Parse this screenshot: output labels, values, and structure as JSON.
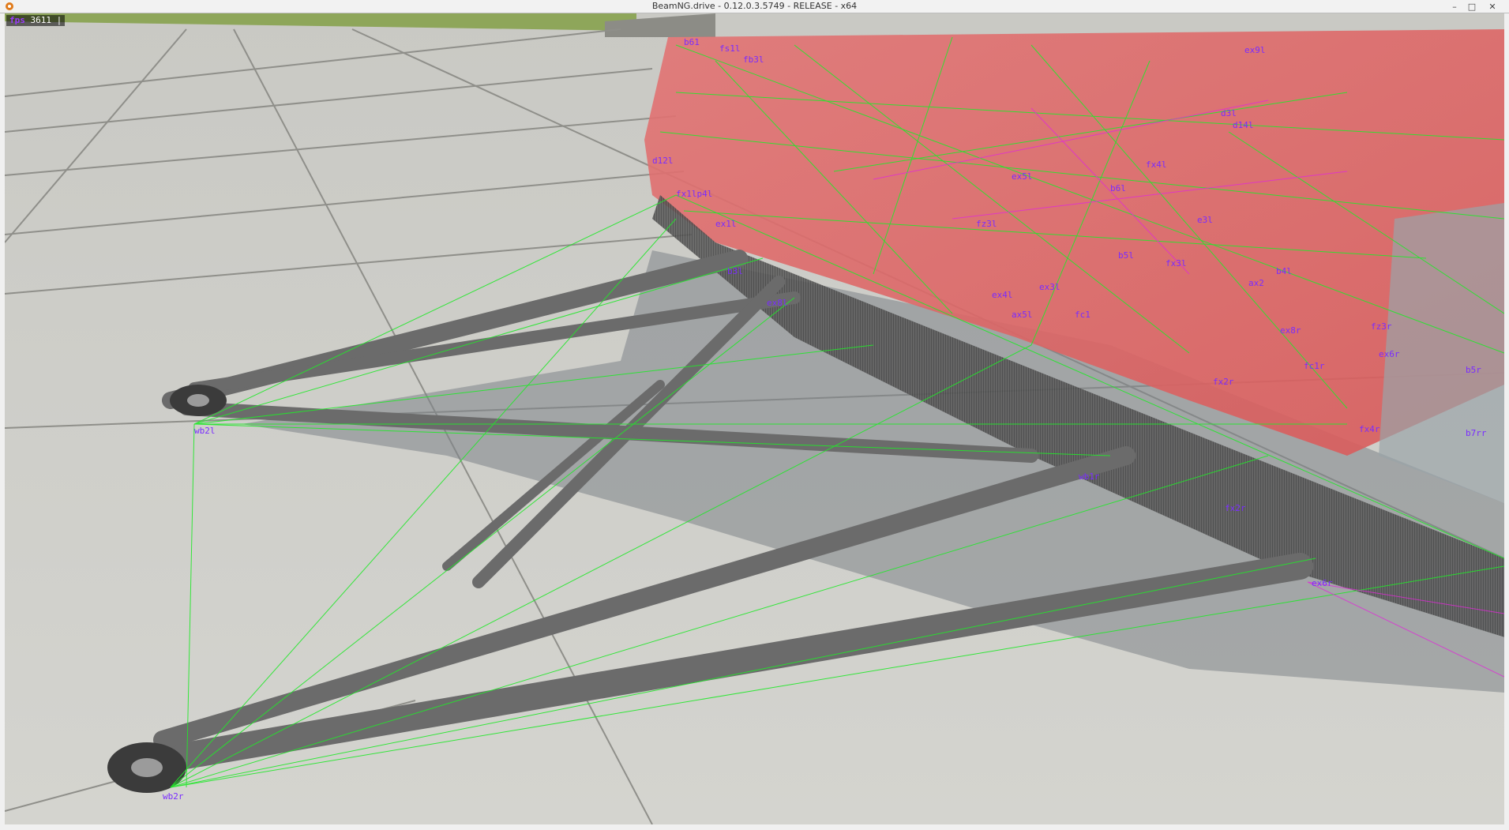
{
  "window": {
    "title": "BeamNG.drive - 0.12.0.3.5749 - RELEASE - x64",
    "controls": {
      "minimize": "–",
      "maximize": "□",
      "close": "✕"
    },
    "app_icon": "beamng-logo-icon"
  },
  "hud": {
    "fps_label": "fps",
    "fps_value": "3611",
    "cursor": "|"
  },
  "node_labels": [
    "b61",
    "fs1l",
    "fb3l",
    "ex9l",
    "d12l",
    "fx1lp4l",
    "ex1l",
    "d3l",
    "d14l",
    "fx4l",
    "b6l",
    "ex5l",
    "fz3l",
    "b3l",
    "ex8l",
    "ax5l",
    "ax2",
    "b4l",
    "ex3l",
    "fx3l",
    "ex4l",
    "e3l",
    "b5l",
    "fc1",
    "ex8r",
    "fz3r",
    "ex6r",
    "fc1r",
    "b5r",
    "fx2r",
    "fx4r",
    "b7rr",
    "wb1r",
    "fx2r",
    "ex6r",
    "wb2l",
    "wb2r"
  ],
  "colors": {
    "wire_green": "#22e82a",
    "wire_magenta": "#e02ad8",
    "label_purple": "#7a2cff",
    "car_body_red": "#e86a6a",
    "ground": "#cfcfcb",
    "fps_bg": "#000000"
  }
}
